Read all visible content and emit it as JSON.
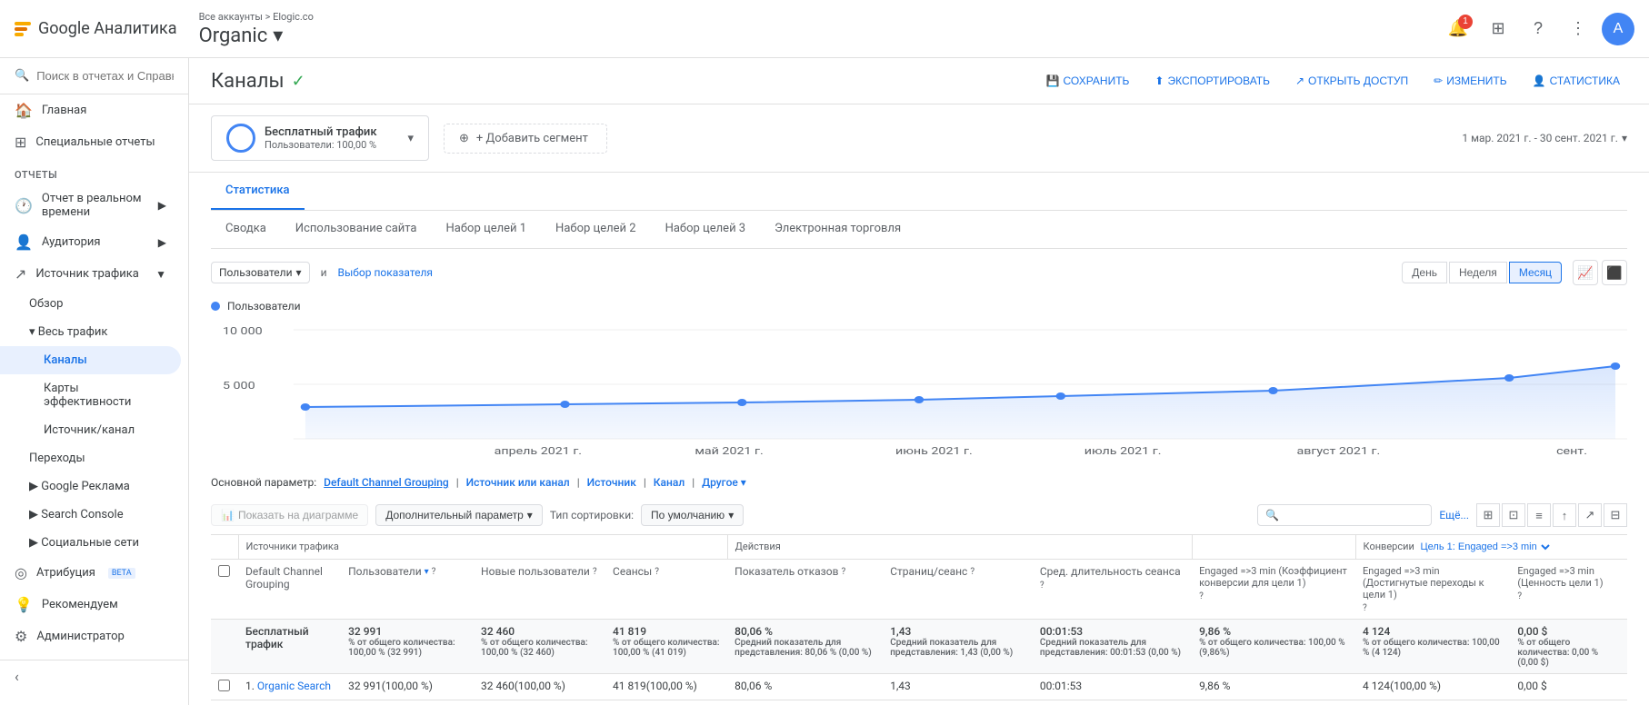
{
  "topbar": {
    "logo_alt": "Google Analytics logo",
    "app_name": "Google Аналитика",
    "account_path": "Все аккаунты > Elogic.co",
    "account_title": "Organic",
    "dropdown_icon": "▾",
    "notification_count": "1",
    "icons": [
      "grid-icon",
      "help-icon",
      "more-icon",
      "avatar-icon"
    ]
  },
  "page": {
    "title": "Каналы",
    "verified": "✓",
    "actions": {
      "save": "СОХРАНИТЬ",
      "export": "ЭКСПОРТИРОВАТЬ",
      "share": "ОТКРЫТЬ ДОСТУП",
      "edit": "ИЗМЕНИТЬ",
      "stats": "СТАТИСТИКА"
    }
  },
  "date_range": "1 мар. 2021 г. - 30 сент. 2021 г.",
  "segment": {
    "name": "Бесплатный трафик",
    "percent": "Пользователи: 100,00 %",
    "add_label": "+ Добавить сегмент"
  },
  "stats_tab": "Статистика",
  "tabs": [
    {
      "label": "Сводка",
      "active": false
    },
    {
      "label": "Использование сайта",
      "active": false
    },
    {
      "label": "Набор целей 1",
      "active": false
    },
    {
      "label": "Набор целей 2",
      "active": false
    },
    {
      "label": "Набор целей 3",
      "active": false
    },
    {
      "label": "Электронная торговля",
      "active": false
    }
  ],
  "chart": {
    "metric_label": "Пользователи",
    "and_label": "и",
    "select_label": "Выбор показателя",
    "time_buttons": [
      {
        "label": "День",
        "active": false
      },
      {
        "label": "Неделя",
        "active": false
      },
      {
        "label": "Месяц",
        "active": true
      }
    ],
    "legend_label": "Пользователи",
    "y_labels": [
      "10 000",
      "5 000"
    ],
    "x_labels": [
      "апрель 2021 г.",
      "май 2021 г.",
      "июнь 2021 г.",
      "июль 2021 г.",
      "август 2021 г.",
      "сент."
    ],
    "data_points": [
      {
        "x": 0.02,
        "y": 0.62
      },
      {
        "x": 0.14,
        "y": 0.6
      },
      {
        "x": 0.26,
        "y": 0.58
      },
      {
        "x": 0.4,
        "y": 0.56
      },
      {
        "x": 0.55,
        "y": 0.54
      },
      {
        "x": 0.68,
        "y": 0.52
      },
      {
        "x": 0.82,
        "y": 0.48
      },
      {
        "x": 0.95,
        "y": 0.38
      },
      {
        "x": 0.99,
        "y": 0.32
      }
    ]
  },
  "table": {
    "primary_param_label": "Основной параметр:",
    "params": [
      {
        "label": "Default Channel Grouping",
        "active": true
      },
      {
        "label": "Источник или канал",
        "active": false
      },
      {
        "label": "Источник",
        "active": false
      },
      {
        "label": "Канал",
        "active": false
      },
      {
        "label": "Другое",
        "active": false
      }
    ],
    "show_chart_btn": "Показать на диаграмме",
    "add_param_btn": "Дополнительный параметр",
    "sort_type_btn": "Тип сортировки:",
    "sort_default": "По умолчанию",
    "search_placeholder": "",
    "more_label": "Ещё...",
    "col_groups": [
      {
        "label": "Источники трафика",
        "span": 4
      },
      {
        "label": "Действия",
        "span": 3
      },
      {
        "label": "",
        "span": 1
      },
      {
        "label": "Конверсии Цель 1: Engaged =>3 min",
        "span": 3
      }
    ],
    "columns": [
      {
        "label": "Default Channel Grouping"
      },
      {
        "label": "Пользователи",
        "sort": true,
        "sub": ""
      },
      {
        "label": "Новые пользователи",
        "sub": ""
      },
      {
        "label": "Сеансы",
        "sub": ""
      },
      {
        "label": "Показатель отказов",
        "sub": ""
      },
      {
        "label": "Страниц/сеанс",
        "sub": ""
      },
      {
        "label": "Сред. длительность сеанса",
        "sub": ""
      },
      {
        "label": "Engaged =>3 min (Коэффициент конверсии для цели 1)",
        "sub": ""
      },
      {
        "label": "Engaged =>3 min (Достигнутые переходы к цели 1)",
        "sub": ""
      },
      {
        "label": "Engaged =>3 min (Ценность цели 1)",
        "sub": ""
      }
    ],
    "total_row": {
      "label": "Бесплатный трафик",
      "users": "32 991",
      "users_sub": "% от общего количества: 100,00 % (32 991)",
      "new_users": "32 460",
      "new_users_sub": "% от общего количества: 100,00 % (32 460)",
      "sessions": "41 819",
      "sessions_sub": "% от общего количества: 100,00 % (41 019)",
      "bounce_rate": "80,06 %",
      "bounce_sub": "Средний показатель для представления: 80,06 % (0,00 %)",
      "pages_session": "1,43",
      "pages_sub": "Средний показатель для представления: 1,43 (0,00 %)",
      "avg_duration": "00:01:53",
      "avg_sub": "Средний показатель для представления: 00:01:53 (0,00 %)",
      "conv_rate": "9,86 %",
      "conv_sub": "% от общего количества: 100,00 % (9,86%)",
      "goal_completions": "4 124",
      "goal_sub": "% от общего количества: 100,00 % (4 124)",
      "goal_value": "0,00 $",
      "goal_val_sub": "% от общего количества: 0,00 % (0,00 $)"
    },
    "rows": [
      {
        "num": "1.",
        "label": "Organic Search",
        "users": "32 991(100,00 %)",
        "new_users": "32 460(100,00 %)",
        "sessions": "41 819(100,00 %)",
        "bounce_rate": "80,06 %",
        "pages_session": "1,43",
        "avg_duration": "00:01:53",
        "conv_rate": "9,86 %",
        "goal_completions": "4 124(100,00 %)",
        "goal_value": "0,00 $"
      }
    ]
  },
  "sidebar": {
    "search_placeholder": "Поиск в отчетах и Справке",
    "items": [
      {
        "label": "Главная",
        "icon": "🏠",
        "level": 0
      },
      {
        "label": "Специальные отчеты",
        "icon": "⊞",
        "level": 0
      },
      {
        "label": "ОТЧЕТЫ",
        "type": "section"
      },
      {
        "label": "Отчет в реальном времени",
        "icon": "🕐",
        "level": 0,
        "expandable": true
      },
      {
        "label": "Аудитория",
        "icon": "👤",
        "level": 0,
        "expandable": true
      },
      {
        "label": "Источник трафика",
        "icon": "↗",
        "level": 0,
        "expandable": true,
        "expanded": true
      },
      {
        "label": "Обзор",
        "icon": "",
        "level": 1
      },
      {
        "label": "Весь трафик",
        "icon": "",
        "level": 1,
        "expandable": true,
        "expanded": true
      },
      {
        "label": "Каналы",
        "icon": "",
        "level": 2,
        "active": true
      },
      {
        "label": "Карты эффективности",
        "icon": "",
        "level": 2
      },
      {
        "label": "Источник/канал",
        "icon": "",
        "level": 2
      },
      {
        "label": "Переходы",
        "icon": "",
        "level": 1
      },
      {
        "label": "Google Реклама",
        "icon": "",
        "level": 1,
        "expandable": true
      },
      {
        "label": "Search Console",
        "icon": "",
        "level": 1,
        "expandable": true
      },
      {
        "label": "Социальные сети",
        "icon": "",
        "level": 1,
        "expandable": true
      },
      {
        "label": "Атрибуция",
        "icon": "◎",
        "level": 0,
        "badge": "BETA"
      },
      {
        "label": "Рекомендуем",
        "icon": "💡",
        "level": 0
      },
      {
        "label": "Администратор",
        "icon": "⚙",
        "level": 0
      }
    ]
  }
}
